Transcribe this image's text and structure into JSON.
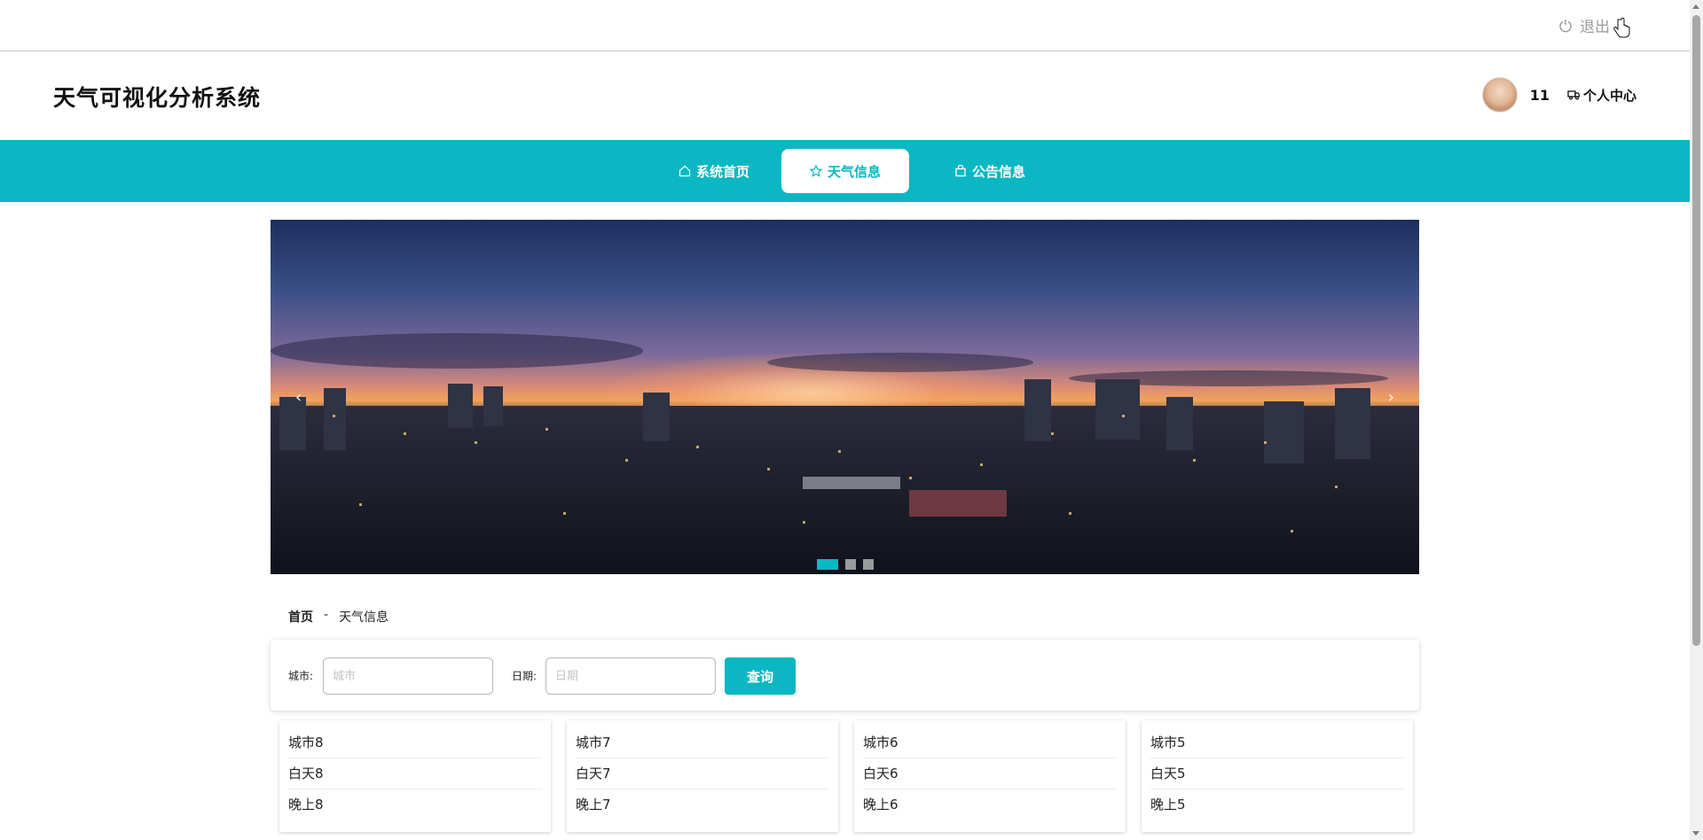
{
  "topbar": {
    "logout_label": "退出"
  },
  "header": {
    "site_title": "天气可视化分析系统",
    "user_name": "11",
    "center_label": "个人中心"
  },
  "nav": {
    "items": [
      {
        "label": "系统首页",
        "icon": "home-icon"
      },
      {
        "label": "天气信息",
        "icon": "star-icon",
        "active": true
      },
      {
        "label": "公告信息",
        "icon": "bag-icon"
      }
    ]
  },
  "carousel": {
    "prev": "‹",
    "next": "›",
    "slide_count": 3,
    "active_index": 0
  },
  "breadcrumb": {
    "home": "首页",
    "separator": "-",
    "current": "天气信息"
  },
  "search": {
    "city_label": "城市:",
    "city_placeholder": "城市",
    "date_label": "日期:",
    "date_placeholder": "日期",
    "button_label": "查询"
  },
  "cards": [
    {
      "city": "城市8",
      "day": "白天8",
      "night": "晚上8"
    },
    {
      "city": "城市7",
      "day": "白天7",
      "night": "晚上7"
    },
    {
      "city": "城市6",
      "day": "白天6",
      "night": "晚上6"
    },
    {
      "city": "城市5",
      "day": "白天5",
      "night": "晚上5"
    }
  ],
  "colors": {
    "accent": "#0ab7c2"
  }
}
